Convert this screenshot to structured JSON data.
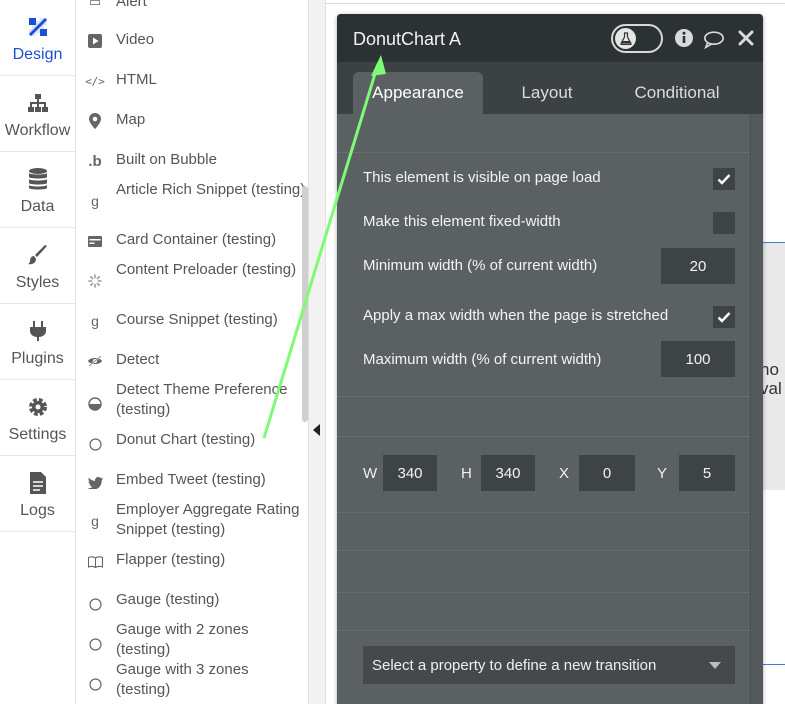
{
  "rail": {
    "items": [
      {
        "label": "Design",
        "icon": "design-icon"
      },
      {
        "label": "Workflow",
        "icon": "workflow-icon"
      },
      {
        "label": "Data",
        "icon": "database-icon"
      },
      {
        "label": "Styles",
        "icon": "brush-icon"
      },
      {
        "label": "Plugins",
        "icon": "plug-icon"
      },
      {
        "label": "Settings",
        "icon": "gear-icon"
      },
      {
        "label": "Logs",
        "icon": "document-icon"
      }
    ]
  },
  "elements": {
    "items": [
      {
        "label": "Alert"
      },
      {
        "label": "Video"
      },
      {
        "label": "HTML"
      },
      {
        "label": "Map"
      },
      {
        "label": "Built on Bubble"
      },
      {
        "label": "Article Rich Snippet (testing)"
      },
      {
        "label": "Card Container (testing)"
      },
      {
        "label": "Content Preloader (testing)"
      },
      {
        "label": "Course Snippet (testing)"
      },
      {
        "label": "Detect"
      },
      {
        "label": "Detect Theme Preference (testing)"
      },
      {
        "label": "Donut Chart (testing)"
      },
      {
        "label": "Embed Tweet (testing)"
      },
      {
        "label": "Employer Aggregate Rating Snippet (testing)"
      },
      {
        "label": "Flapper (testing)"
      },
      {
        "label": "Gauge (testing)"
      },
      {
        "label": "Gauge with 2 zones (testing)"
      },
      {
        "label": "Gauge with 3 zones (testing)"
      }
    ]
  },
  "canvas": {
    "text": "no\nval"
  },
  "editor": {
    "title": "DonutChart A",
    "tabs": [
      {
        "label": "Appearance"
      },
      {
        "label": "Layout"
      },
      {
        "label": "Conditional"
      }
    ],
    "visible_label": "This element is visible on page load",
    "visible_checked": true,
    "fixed_width_label": "Make this element fixed-width",
    "fixed_width_checked": false,
    "min_width_label": "Minimum width (% of current width)",
    "min_width_value": "20",
    "max_width_toggle_label": "Apply a max width when the page is stretched",
    "max_width_toggle_checked": true,
    "max_width_label": "Maximum width (% of current width)",
    "max_width_value": "100",
    "dims": {
      "w_label": "W",
      "w_value": "340",
      "h_label": "H",
      "h_value": "340",
      "x_label": "X",
      "x_value": "0",
      "y_label": "Y",
      "y_value": "5"
    },
    "transition_placeholder": "Select a property to define a new transition"
  },
  "colors": {
    "accent": "#1a4fd6",
    "panel_bg": "#5b6063",
    "panel_header": "#2c3134",
    "arrow": "#7dfb76"
  }
}
